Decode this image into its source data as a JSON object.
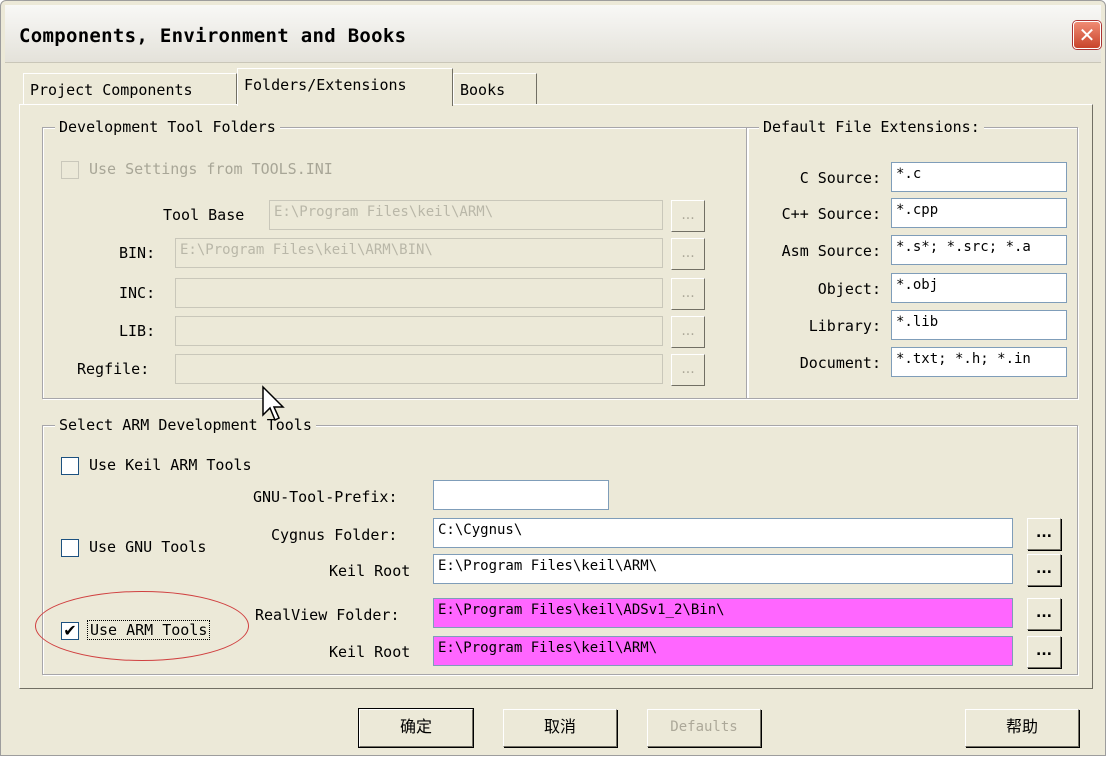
{
  "window": {
    "title": "Components, Environment and Books",
    "close_glyph": "✕"
  },
  "tabs": [
    {
      "label": "Project Components"
    },
    {
      "label": "Folders/Extensions"
    },
    {
      "label": "Books"
    }
  ],
  "dev_folders": {
    "legend": "Development Tool Folders",
    "use_settings_label": "Use Settings from TOOLS.INI",
    "tool_base_label": "Tool Base",
    "tool_base_value": "E:\\Program Files\\keil\\ARM\\",
    "bin_label": "BIN:",
    "bin_value": "E:\\Program Files\\keil\\ARM\\BIN\\",
    "inc_label": "INC:",
    "inc_value": "",
    "lib_label": "LIB:",
    "lib_value": "",
    "regfile_label": "Regfile:",
    "regfile_value": "",
    "browse_label": "..."
  },
  "extensions": {
    "legend": "Default File Extensions:",
    "rows": [
      {
        "label": "C Source:",
        "value": "*.c"
      },
      {
        "label": "C++ Source:",
        "value": "*.cpp"
      },
      {
        "label": "Asm Source:",
        "value": "*.s*; *.src; *.a"
      },
      {
        "label": "Object:",
        "value": "*.obj"
      },
      {
        "label": "Library:",
        "value": "*.lib"
      },
      {
        "label": "Document:",
        "value": "*.txt; *.h; *.in"
      }
    ]
  },
  "arm_tools": {
    "legend": "Select ARM Development Tools",
    "use_keil_label": "Use Keil ARM Tools",
    "use_keil_checked": false,
    "gnu_prefix_label": "GNU-Tool-Prefix:",
    "gnu_prefix_value": "",
    "use_gnu_label": "Use GNU Tools",
    "use_gnu_checked": false,
    "cygnus_label": "Cygnus Folder:",
    "cygnus_value": "C:\\Cygnus\\",
    "keil_root_label": "Keil Root",
    "keil_root_gnu_value": "E:\\Program Files\\keil\\ARM\\",
    "use_arm_label": "Use ARM Tools",
    "use_arm_checked": true,
    "check_glyph": "✔",
    "realview_label": "RealView Folder:",
    "realview_value": "E:\\Program Files\\keil\\ADSv1_2\\Bin\\",
    "keil_root_arm_value": "E:\\Program Files\\keil\\ARM\\",
    "browse_label": "..."
  },
  "buttons": {
    "ok": "确定",
    "cancel": "取消",
    "defaults": "Defaults",
    "help": "帮助"
  },
  "colors": {
    "highlight_field": "#ff66ff",
    "annotation_ring": "#d04040"
  }
}
